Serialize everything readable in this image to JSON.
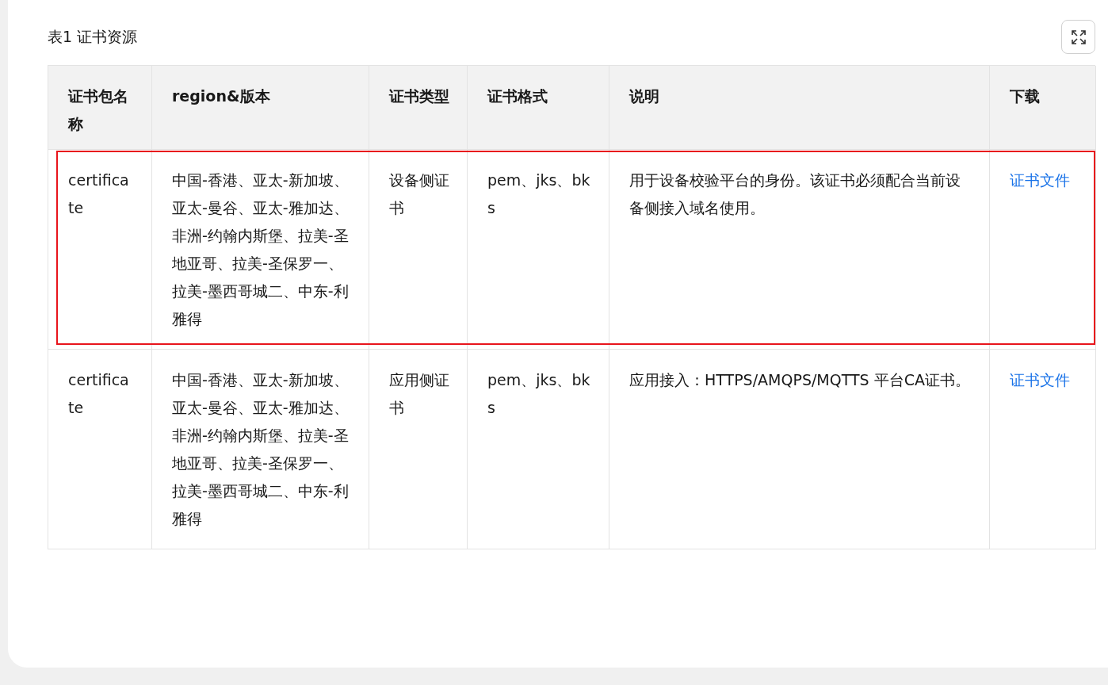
{
  "table": {
    "caption": "表1 证书资源",
    "columns": [
      "证书包名称",
      "region&版本",
      "证书类型",
      "证书格式",
      "说明",
      "下载"
    ],
    "rows": [
      {
        "highlighted": true,
        "cells": [
          "certificate",
          "中国-香港、亚太-新加坡、亚太-曼谷、亚太-雅加达、非洲-约翰内斯堡、拉美-圣地亚哥、拉美-圣保罗一、拉美-墨西哥城二、中东-利雅得",
          "设备侧证书",
          "pem、jks、bks",
          "用于设备校验平台的身份。该证书必须配合当前设备侧接入域名使用。",
          "证书文件"
        ]
      },
      {
        "highlighted": false,
        "cells": [
          "certificate",
          "中国-香港、亚太-新加坡、亚太-曼谷、亚太-雅加达、非洲-约翰内斯堡、拉美-圣地亚哥、拉美-圣保罗一、拉美-墨西哥城二、中东-利雅得",
          "应用侧证书",
          "pem、jks、bks",
          "应用接入：HTTPS/AMQPS/MQTTS 平台CA证书。",
          "证书文件"
        ]
      }
    ]
  }
}
